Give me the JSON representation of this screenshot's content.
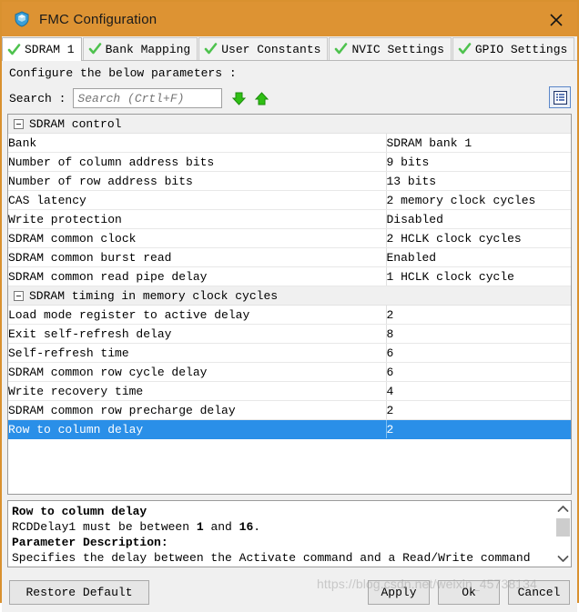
{
  "window": {
    "title": "FMC Configuration",
    "title_icon": "shield-icon",
    "close_icon": "close-icon",
    "accent_color": "#dd9333",
    "selection_color": "#2a8fe8"
  },
  "tabs": [
    {
      "label": "SDRAM 1",
      "active": true,
      "icon": "green-check-icon"
    },
    {
      "label": "Bank Mapping",
      "active": false,
      "icon": "green-check-icon"
    },
    {
      "label": "User Constants",
      "active": false,
      "icon": "green-check-icon"
    },
    {
      "label": "NVIC Settings",
      "active": false,
      "icon": "green-check-icon"
    },
    {
      "label": "GPIO Settings",
      "active": false,
      "icon": "green-check-icon"
    }
  ],
  "instruction": "Configure the below parameters :",
  "search": {
    "label": "Search :",
    "value": "",
    "placeholder": "Search (Crtl+F)",
    "next_icon": "arrow-down-icon",
    "prev_icon": "arrow-up-icon",
    "view_toggle_icon": "list-view-icon"
  },
  "table": {
    "groups": [
      {
        "label": "SDRAM control",
        "expanded": true,
        "rows": [
          {
            "name": "Bank",
            "value": "SDRAM bank 1",
            "selected": false
          },
          {
            "name": "Number of column address bits",
            "value": "9 bits",
            "selected": false
          },
          {
            "name": "Number of row address bits",
            "value": "13 bits",
            "selected": false
          },
          {
            "name": "CAS latency",
            "value": "2 memory clock cycles",
            "selected": false
          },
          {
            "name": "Write protection",
            "value": "Disabled",
            "selected": false
          },
          {
            "name": "SDRAM common clock",
            "value": "2 HCLK clock cycles",
            "selected": false
          },
          {
            "name": "SDRAM common burst read",
            "value": "Enabled",
            "selected": false
          },
          {
            "name": "SDRAM common read pipe delay",
            "value": "1 HCLK clock cycle",
            "selected": false
          }
        ]
      },
      {
        "label": "SDRAM timing in memory clock cycles",
        "expanded": true,
        "rows": [
          {
            "name": "Load mode register to active delay",
            "value": "2",
            "selected": false
          },
          {
            "name": "Exit self-refresh delay",
            "value": "8",
            "selected": false
          },
          {
            "name": "Self-refresh time",
            "value": "6",
            "selected": false
          },
          {
            "name": "SDRAM common row cycle delay",
            "value": "6",
            "selected": false
          },
          {
            "name": "Write recovery time",
            "value": "4",
            "selected": false
          },
          {
            "name": "SDRAM common row precharge delay",
            "value": "2",
            "selected": false
          },
          {
            "name": "Row to column delay",
            "value": "2",
            "selected": true
          }
        ]
      }
    ]
  },
  "description": {
    "title": "Row to column delay",
    "constraint_prefix": "RCDDelay1 must be between ",
    "constraint_min": "1",
    "constraint_mid": " and ",
    "constraint_max": "16",
    "constraint_suffix": ".",
    "section_heading": "Parameter Description:",
    "body_clipped": "Specifies the delay between the Activate command and a Read/Write command",
    "scroll_up_icon": "chevron-up-icon",
    "scroll_down_icon": "chevron-down-icon"
  },
  "footer": {
    "restore": "Restore Default",
    "apply": "Apply",
    "ok": "Ok",
    "cancel": "Cancel"
  },
  "watermark": "https://blog.csdn.net/weixin_45738134"
}
